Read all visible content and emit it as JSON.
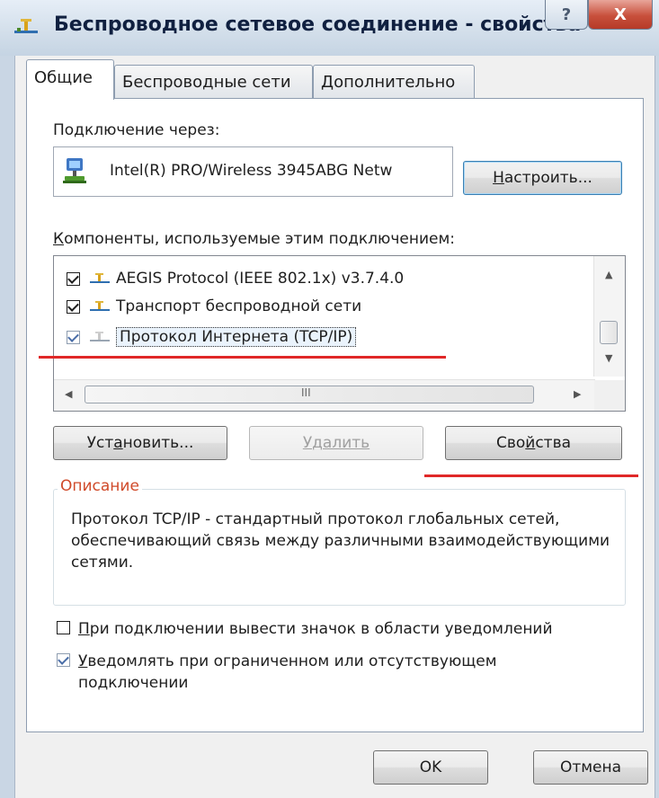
{
  "window": {
    "title": "Беспроводное сетевое соединение - свойства",
    "help_label": "?",
    "close_label": "X"
  },
  "tabs": [
    {
      "label": "Общие",
      "active": true
    },
    {
      "label": "Беспроводные сети",
      "active": false
    },
    {
      "label": "Дополнительно",
      "active": false
    }
  ],
  "connection": {
    "via_label": "Подключение через:",
    "adapter_name": "Intel(R) PRO/Wireless 3945ABG Netw",
    "configure_button_pre": "",
    "configure_button_u": "Н",
    "configure_button_post": "астроить..."
  },
  "components": {
    "label_u": "К",
    "label_rest": "омпоненты, используемые этим подключением:",
    "items": [
      {
        "label": "AEGIS Protocol (IEEE 802.1x) v3.7.4.0",
        "checked": true,
        "selected": false,
        "icon": "network-protocol-icon"
      },
      {
        "label": "Транспорт беспроводной сети",
        "checked": true,
        "selected": false,
        "icon": "network-protocol-icon"
      },
      {
        "label": "Протокол Интернета (TCP/IP)",
        "checked": true,
        "selected": true,
        "icon": "network-protocol-icon"
      }
    ],
    "hscroll_grip": "III"
  },
  "actions": {
    "install_pre": "Уст",
    "install_u": "а",
    "install_post": "новить...",
    "remove_label": "Удалить",
    "properties_pre": "Сво",
    "properties_u": "й",
    "properties_post": "ства"
  },
  "description": {
    "title": "Описание",
    "text": "Протокол TCP/IP - стандартный протокол глобальных сетей, обеспечивающий связь между различными взаимодействующими сетями."
  },
  "options": [
    {
      "label_u": "П",
      "label_rest": "ри подключении вывести значок в области уведомлений",
      "checked": false
    },
    {
      "label_u": "У",
      "label_rest": "ведомлять при ограниченном или отсутствующем подключении",
      "checked": true
    }
  ],
  "footer": {
    "ok_label": "OK",
    "cancel_label": "Отмена"
  },
  "colors": {
    "annotation_underline": "#e02828",
    "group_title": "#d04a2a"
  }
}
